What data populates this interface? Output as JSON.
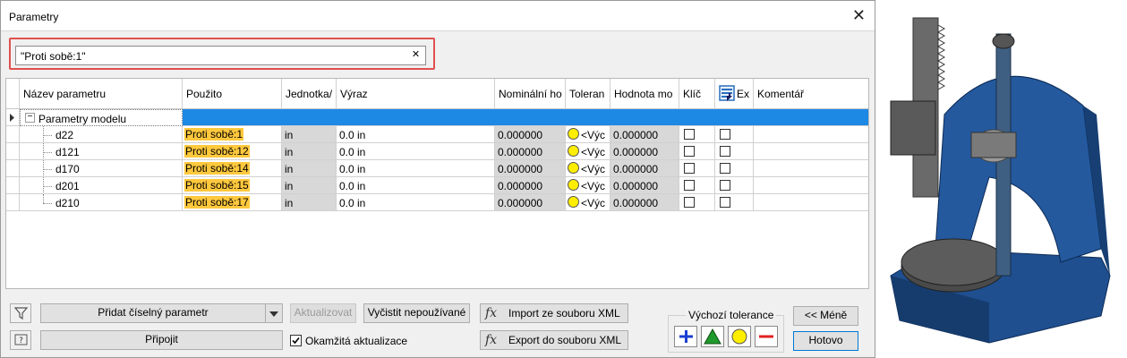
{
  "window": {
    "title": "Parametry",
    "close_glyph": "✕"
  },
  "search": {
    "value": "\"Proti sobě:1\"",
    "clear_glyph": "✕"
  },
  "columns": [
    "Název parametru",
    "Použito",
    "Jednotka/",
    "Výraz",
    "Nominální ho",
    "Toleran",
    "Hodnota mo",
    "Klíč",
    "Ex",
    "Komentář"
  ],
  "group_row": {
    "label": "Parametry modelu",
    "expander": "−"
  },
  "rows": [
    {
      "name": "d22",
      "used": "Proti sobě:1",
      "unit": "in",
      "expr": "0.0 in",
      "nominal": "0.000000",
      "tol": "<Výc",
      "model": "0.000000"
    },
    {
      "name": "d121",
      "used": "Proti sobě:12",
      "unit": "in",
      "expr": "0.0 in",
      "nominal": "0.000000",
      "tol": "<Výc",
      "model": "0.000000"
    },
    {
      "name": "d170",
      "used": "Proti sobě:14",
      "unit": "in",
      "expr": "0.0 in",
      "nominal": "0.000000",
      "tol": "<Výc",
      "model": "0.000000"
    },
    {
      "name": "d201",
      "used": "Proti sobě:15",
      "unit": "in",
      "expr": "0.0 in",
      "nominal": "0.000000",
      "tol": "<Výc",
      "model": "0.000000"
    },
    {
      "name": "d210",
      "used": "Proti sobě:17",
      "unit": "in",
      "expr": "0.0 in",
      "nominal": "0.000000",
      "tol": "<Výc",
      "model": "0.000000"
    }
  ],
  "buttons": {
    "add_numeric": "Přidat číselný parametr",
    "link": "Připojit",
    "update": "Aktualizovat",
    "purge": "Vyčistit nepoužívané",
    "immediate_update": "Okamžitá aktualizace",
    "import_xml": "Import ze souboru XML",
    "export_xml": "Export do souboru XML",
    "less": "<< Méně",
    "done": "Hotovo"
  },
  "default_tolerance": {
    "label": "Výchozí tolerance"
  },
  "fx_glyph": "fx",
  "colors": {
    "selection": "#1e88e5",
    "used_highlight": "#ffc83d",
    "model_blue": "#1f4f8f"
  }
}
